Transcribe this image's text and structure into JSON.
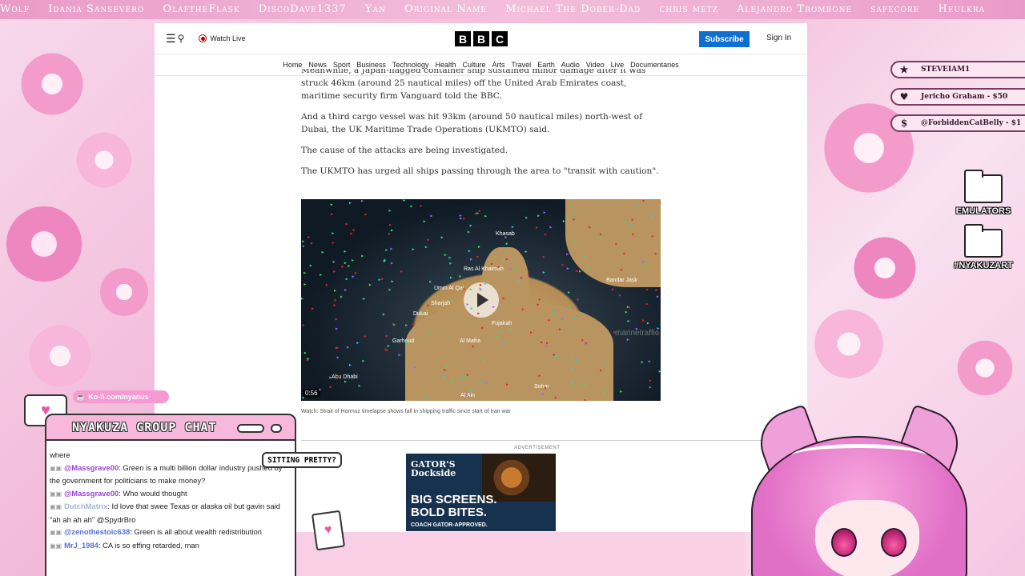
{
  "ticker": [
    "Wolf",
    "Idania Sansevero",
    "OlaftheFlask",
    "DiscoDave1337",
    "Yan",
    "Original Name",
    "Michael The Dober-Dad",
    "chris metz",
    "Alejandro Trombone",
    "safecore",
    "Heulkra"
  ],
  "bbc": {
    "watch_live": "Watch Live",
    "logo": [
      "B",
      "B",
      "C"
    ],
    "subscribe": "Subscribe",
    "sign_in": "Sign In",
    "nav": [
      "Home",
      "News",
      "Sport",
      "Business",
      "Technology",
      "Health",
      "Culture",
      "Arts",
      "Travel",
      "Earth",
      "Audio",
      "Video",
      "Live",
      "Documentaries"
    ],
    "paragraphs": [
      "Meanwhile, a Japan-flagged container ship sustained minor damage after it was struck 46km (around 25 nautical miles) off the United Arab Emirates coast, maritime security firm Vanguard told the BBC.",
      "And a third cargo vessel was hit 93km (around 50 nautical miles) north-west of Dubai, the UK Maritime Trade Operations (UKMTO) said.",
      "The cause of the attacks are being investigated.",
      "The UKMTO has urged all ships passing through the area to \"transit with caution\"."
    ],
    "video": {
      "duration": "0:56",
      "labels": [
        "Khasab",
        "Ras Al Khaimah",
        "Umm Al Qai",
        "Dubai",
        "Sharjah",
        "Fujairah",
        "Garhoud",
        "Al Mafra",
        "Abu Dhabi",
        "Sohar",
        "Al Ain",
        "Bandar Jask",
        "marinetraffic"
      ]
    },
    "caption": "Watch: Strait of Hormuz timelapse shows fall in shipping traffic since start of Iran war",
    "advert_label": "ADVERTISEMENT",
    "ad": {
      "brand": "GATOR'S",
      "brand2": "Dockside",
      "headline1": "BIG SCREENS.",
      "headline2": "BOLD BITES.",
      "sub": "COACH GATOR-APPROVED."
    }
  },
  "donors": [
    {
      "icon": "star-icon",
      "glyph": "★",
      "label": "STEVEIAM1"
    },
    {
      "icon": "heart-icon",
      "glyph": "♥",
      "label": "Jericho Graham - $50"
    },
    {
      "icon": "dollar-icon",
      "glyph": "$",
      "label": "@ForbiddenCatBelly - $1"
    }
  ],
  "folders": [
    "EMULATORS",
    "#NYAKUZART"
  ],
  "kofi": "Ko-fi.com/nyanus",
  "chat": {
    "title": "NYAKUZA GROUP CHAT",
    "bubble": "SITTING PRETTY?",
    "messages": [
      {
        "user": "",
        "text": "where"
      },
      {
        "user": "@Massgrave00",
        "text": ": Green is a multi billion dollar industry pushed by the government for politicians to make money?"
      },
      {
        "user": "@Massgrave00",
        "text": ": Who would thought"
      },
      {
        "user": "DutchMatrix",
        "text": ": Id love that swee Texas or alaska oil but gavin said \"ah ah ah ah\" @SpydrBro"
      },
      {
        "user": "@zenothestoic638",
        "text": ": Green is all about wealth redistribution"
      },
      {
        "user": "MrJ_1984",
        "text": ": CA is so effing retarded, man"
      }
    ]
  }
}
